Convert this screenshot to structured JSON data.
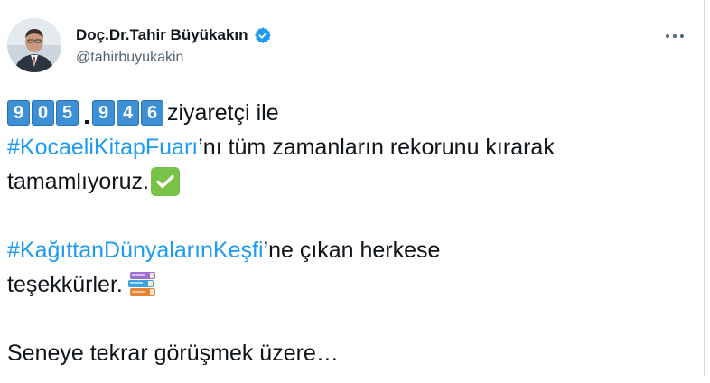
{
  "author": {
    "display_name": "Doç.Dr.Tahir Büyükakın",
    "handle": "@tahirbuyukakin"
  },
  "icons": {
    "avatar": "profile-photo",
    "verified": "verified-badge-icon",
    "more": "more-options-icon",
    "check": "check-mark-button-emoji",
    "books": "books-emoji"
  },
  "colors": {
    "link": "#1d9bf0",
    "verified": "#1d9bf0",
    "check": "#78c248",
    "keycap": "#3d8fd6"
  },
  "tweet": {
    "visitor_digits": [
      "9",
      "0",
      "5",
      "9",
      "4",
      "6"
    ],
    "line1_text": "ziyaretçi ile",
    "hashtag1": "#KocaeliKitapFuarı",
    "line2_text": "’nı tüm zamanların rekorunu kırarak",
    "line3_text": "tamamlıyoruz.",
    "hashtag2": "#KağıttanDünyalarınKeşfi",
    "line4_text": "’ne çıkan herkese",
    "line5_text": "teşekkürler.",
    "line6_text": "Seneye tekrar görüşmek üzere…"
  }
}
